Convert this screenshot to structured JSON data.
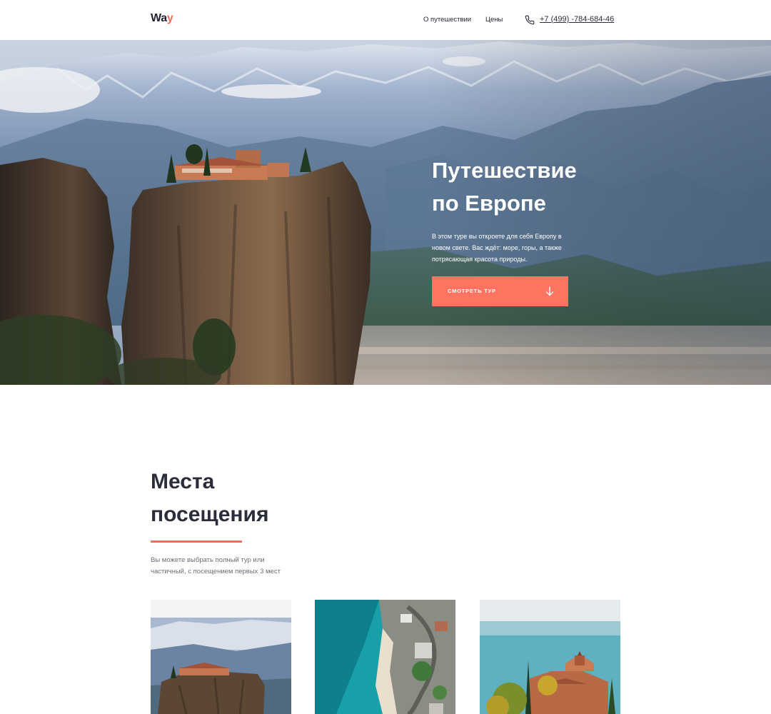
{
  "header": {
    "logo_main": "Wa",
    "logo_accent": "y",
    "nav": {
      "about": "О путешествии",
      "prices": "Цены"
    },
    "phone": "+7 (499) -784-684-46"
  },
  "hero": {
    "title_line1": "Путешествие",
    "title_line2": "по Европе",
    "description": "В этом туре вы откроете для себя Европу в новом свете. Вас ждёт: море, горы, а также потрясающая красота природы.",
    "button_label": "Смотреть тур"
  },
  "places": {
    "title_line1": "Места",
    "title_line2": "посещения",
    "description": "Вы можете выбрать полный тур или частичный, с посещением первых 3 мест"
  },
  "colors": {
    "accent": "#ff7460",
    "text_dark": "#2b2d3a",
    "text_muted": "#6b6d78"
  }
}
